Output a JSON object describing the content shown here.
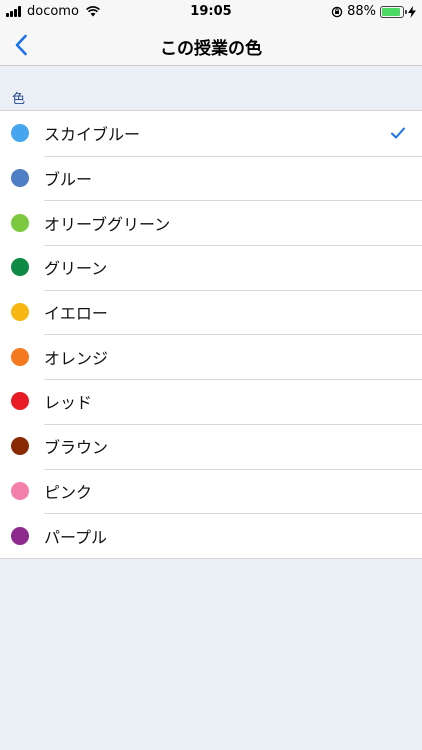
{
  "status_bar": {
    "carrier": "docomo",
    "time": "19:05",
    "battery_percent": "88%",
    "battery_level": 0.88,
    "battery_color": "#4cd964"
  },
  "nav": {
    "back_icon": "chevron-left-icon",
    "title": "この授業の色"
  },
  "section": {
    "header": "色"
  },
  "colors": [
    {
      "label": "スカイブルー",
      "color": "#45a6ef",
      "selected": true
    },
    {
      "label": "ブルー",
      "color": "#4e7ec4",
      "selected": false
    },
    {
      "label": "オリーブグリーン",
      "color": "#7cc940",
      "selected": false
    },
    {
      "label": "グリーン",
      "color": "#0e8a45",
      "selected": false
    },
    {
      "label": "イエロー",
      "color": "#f7b611",
      "selected": false
    },
    {
      "label": "オレンジ",
      "color": "#f57a1f",
      "selected": false
    },
    {
      "label": "レッド",
      "color": "#e81c24",
      "selected": false
    },
    {
      "label": "ブラウン",
      "color": "#8a2a05",
      "selected": false
    },
    {
      "label": "ピンク",
      "color": "#f47fab",
      "selected": false
    },
    {
      "label": "パープル",
      "color": "#8e2a8e",
      "selected": false
    }
  ],
  "accent_color": "#1a73e8"
}
